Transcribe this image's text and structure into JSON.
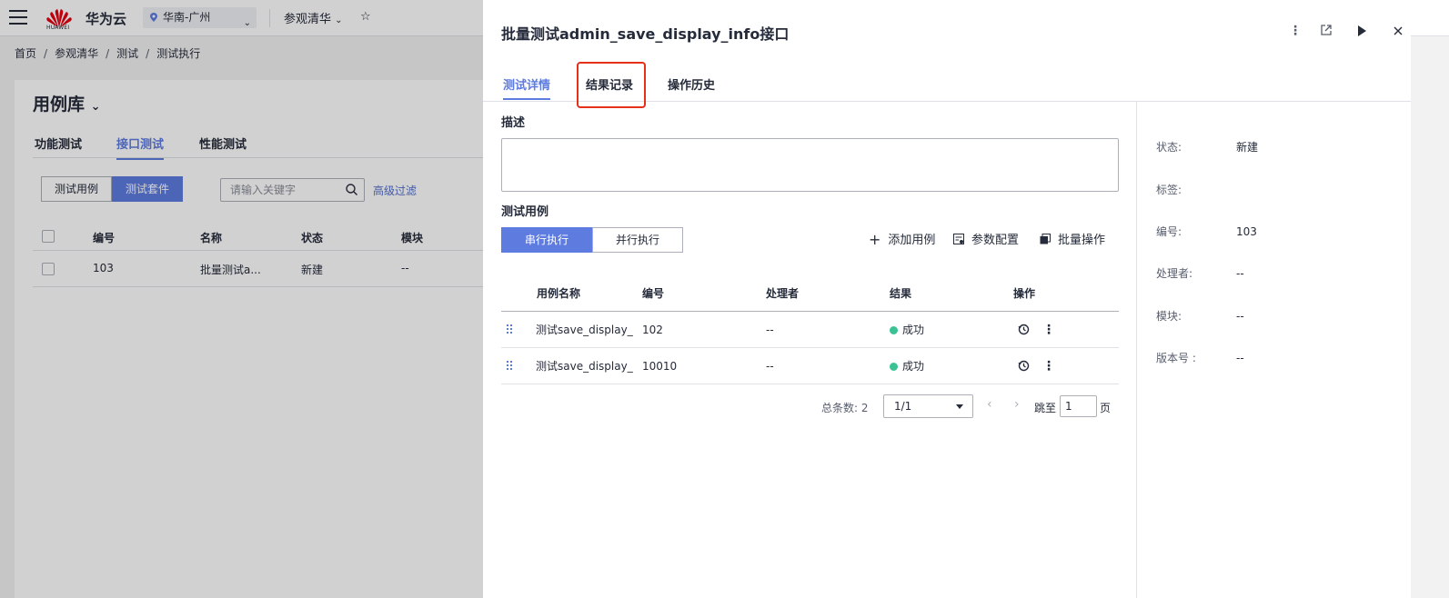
{
  "topbar": {
    "brand": "华为云",
    "logo_text": "HUAWEI",
    "region": "华南-广州",
    "project": "参观清华"
  },
  "breadcrumb": [
    "首页",
    "参观清华",
    "测试",
    "测试执行"
  ],
  "library": {
    "title": "用例库",
    "tabs": [
      "功能测试",
      "接口测试",
      "性能测试"
    ],
    "active_tab": "接口测试",
    "segments": [
      "测试用例",
      "测试套件"
    ],
    "search_placeholder": "请输入关键字",
    "advanced_filter": "高级过滤",
    "columns": [
      "编号",
      "名称",
      "状态",
      "模块"
    ],
    "rows": [
      {
        "id": "103",
        "name": "批量测试a...",
        "status": "新建",
        "module": "--"
      }
    ]
  },
  "drawer": {
    "title": "批量测试admin_save_display_info接口",
    "tabs": [
      "测试详情",
      "结果记录",
      "操作历史"
    ],
    "active_tab": "测试详情",
    "highlighted_tab": "结果记录",
    "description_label": "描述",
    "description_value": "",
    "cases_label": "测试用例",
    "exec_modes": [
      "串行执行",
      "并行执行"
    ],
    "active_exec_mode": "串行执行",
    "tools": {
      "add": "添加用例",
      "params": "参数配置",
      "batch": "批量操作"
    },
    "case_columns": [
      "用例名称",
      "编号",
      "处理者",
      "结果",
      "操作"
    ],
    "cases": [
      {
        "name": "测试save_display_",
        "id": "102",
        "handler": "--",
        "result": "成功"
      },
      {
        "name": "测试save_display_",
        "id": "10010",
        "handler": "--",
        "result": "成功"
      }
    ],
    "pager": {
      "total_label": "总条数: 2",
      "page": "1/1",
      "jump_label": "跳至",
      "jump_value": "1",
      "page_unit": "页"
    },
    "properties": [
      {
        "key": "状态:",
        "value": "新建"
      },
      {
        "key": "标签:",
        "value": ""
      },
      {
        "key": "编号:",
        "value": "103"
      },
      {
        "key": "处理者:",
        "value": "--"
      },
      {
        "key": "模块:",
        "value": "--"
      },
      {
        "key": "版本号 :",
        "value": "--"
      }
    ]
  },
  "colors": {
    "accent": "#5e7ce0",
    "success": "#3ac295",
    "highlight_border": "#e5301a",
    "brand_red": "#e60012"
  },
  "icons": [
    "menu-icon",
    "huawei-logo",
    "location-pin-icon",
    "chevron-down-icon",
    "star-icon",
    "search-icon",
    "more-vertical-icon",
    "share-icon",
    "play-icon",
    "close-icon",
    "plus-icon",
    "settings-doc-icon",
    "batch-icon",
    "drag-handle-icon",
    "history-icon"
  ]
}
